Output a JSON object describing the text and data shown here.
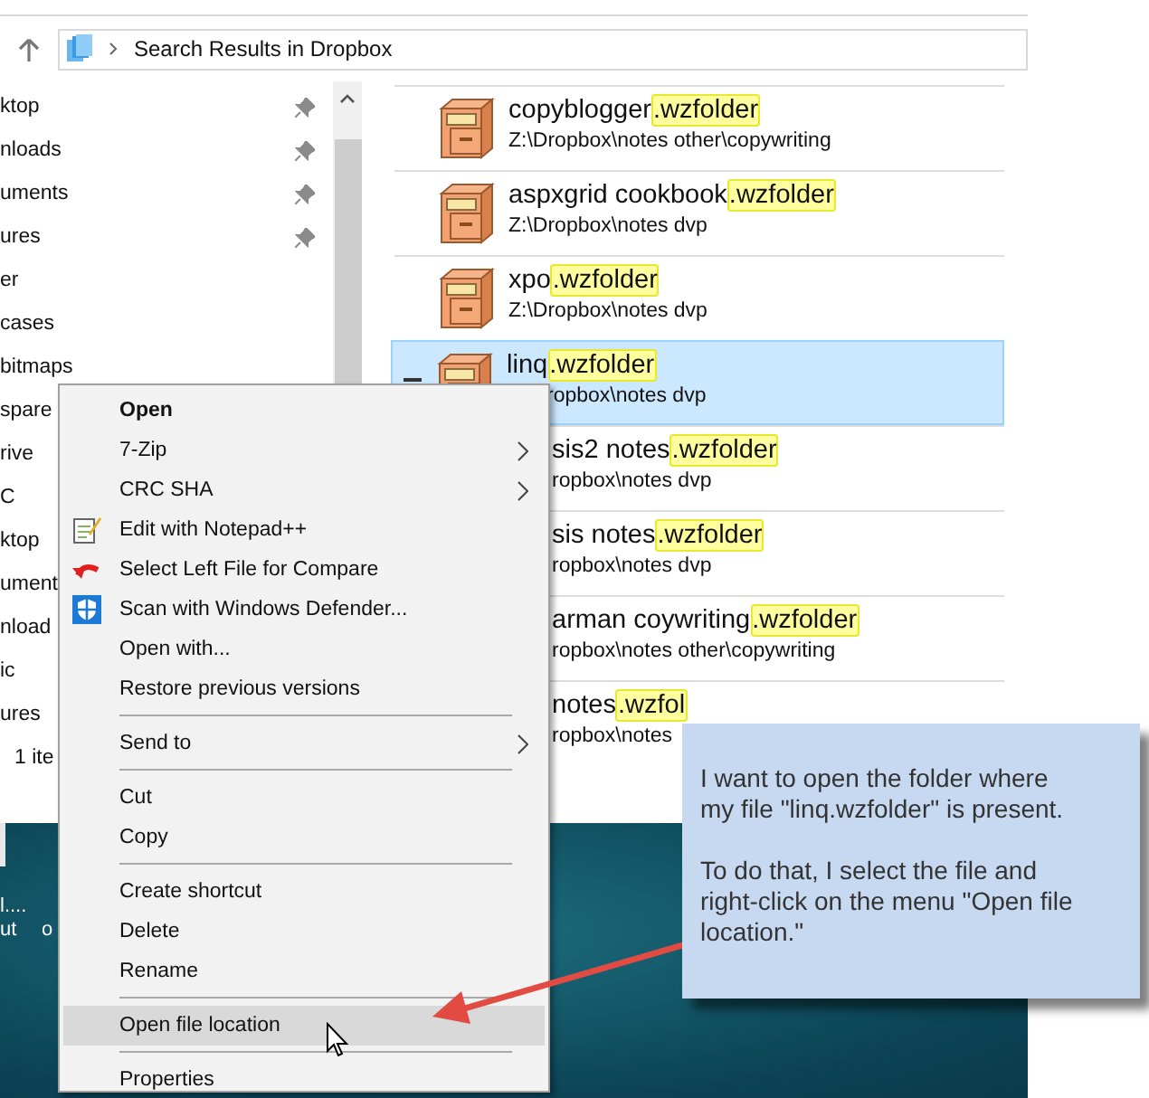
{
  "address_bar": {
    "path": "Search Results in Dropbox"
  },
  "nav_items": [
    {
      "label": "ktop",
      "pinned": true
    },
    {
      "label": "nloads",
      "pinned": true
    },
    {
      "label": "uments",
      "pinned": true
    },
    {
      "label": "ures",
      "pinned": true
    },
    {
      "label": "er",
      "pinned": false
    },
    {
      "label": "cases",
      "pinned": false
    },
    {
      "label": "bitmaps",
      "pinned": false
    },
    {
      "label": "spare",
      "pinned": false
    },
    {
      "label": "rive",
      "pinned": false
    },
    {
      "label": "C",
      "pinned": false
    },
    {
      "label": "ktop",
      "pinned": false
    },
    {
      "label": "ument",
      "pinned": false
    },
    {
      "label": "nload",
      "pinned": false
    },
    {
      "label": "ic",
      "pinned": false
    },
    {
      "label": "ures",
      "pinned": false
    }
  ],
  "status_bar": "1 ite",
  "results": [
    {
      "name": "copyblogger",
      "match": ".wzfolder",
      "path": "Z:\\Dropbox\\notes other\\copywriting",
      "selected": false,
      "covered": false
    },
    {
      "name": "aspxgrid cookbook",
      "match": ".wzfolder",
      "path": "Z:\\Dropbox\\notes dvp",
      "selected": false,
      "covered": false
    },
    {
      "name": "xpo",
      "match": ".wzfolder",
      "path": "Z:\\Dropbox\\notes dvp",
      "selected": false,
      "covered": false
    },
    {
      "name": "linq",
      "match": ".wzfolder",
      "path": "ropbox\\notes dvp",
      "selected": true,
      "covered": false
    },
    {
      "name": "sis2 notes",
      "match": ".wzfolder",
      "path": "ropbox\\notes dvp",
      "selected": false,
      "covered": true
    },
    {
      "name": "sis notes",
      "match": ".wzfolder",
      "path": "ropbox\\notes dvp",
      "selected": false,
      "covered": true
    },
    {
      "name": "arman coywriting",
      "match": ".wzfolder",
      "path": "ropbox\\notes other\\copywriting",
      "selected": false,
      "covered": true
    },
    {
      "name": "notes",
      "match": ".wzfol",
      "path": "ropbox\\notes",
      "selected": false,
      "covered": true
    }
  ],
  "desktop_labels": [
    "l....",
    "ut",
    "o"
  ],
  "context_menu": [
    {
      "kind": "item",
      "label": "Open",
      "bold": true,
      "submenu": false,
      "selected": false
    },
    {
      "kind": "item",
      "label": "7-Zip",
      "bold": false,
      "submenu": true,
      "selected": false
    },
    {
      "kind": "item",
      "label": "CRC SHA",
      "bold": false,
      "submenu": true,
      "selected": false
    },
    {
      "kind": "item",
      "label": "Edit with Notepad++",
      "bold": false,
      "submenu": false,
      "selected": false
    },
    {
      "kind": "item",
      "label": "Select Left File for Compare",
      "bold": false,
      "submenu": false,
      "selected": false
    },
    {
      "kind": "item",
      "label": "Scan with Windows Defender...",
      "bold": false,
      "submenu": false,
      "selected": false
    },
    {
      "kind": "item",
      "label": "Open with...",
      "bold": false,
      "submenu": false,
      "selected": false
    },
    {
      "kind": "item",
      "label": "Restore previous versions",
      "bold": false,
      "submenu": false,
      "selected": false
    },
    {
      "kind": "separator"
    },
    {
      "kind": "item",
      "label": "Send to",
      "bold": false,
      "submenu": true,
      "selected": false
    },
    {
      "kind": "separator"
    },
    {
      "kind": "item",
      "label": "Cut",
      "bold": false,
      "submenu": false,
      "selected": false
    },
    {
      "kind": "item",
      "label": "Copy",
      "bold": false,
      "submenu": false,
      "selected": false
    },
    {
      "kind": "separator"
    },
    {
      "kind": "item",
      "label": "Create shortcut",
      "bold": false,
      "submenu": false,
      "selected": false
    },
    {
      "kind": "item",
      "label": "Delete",
      "bold": false,
      "submenu": false,
      "selected": false
    },
    {
      "kind": "item",
      "label": "Rename",
      "bold": false,
      "submenu": false,
      "selected": false
    },
    {
      "kind": "separator"
    },
    {
      "kind": "item",
      "label": "Open file location",
      "bold": false,
      "submenu": false,
      "selected": true
    },
    {
      "kind": "separator"
    },
    {
      "kind": "item",
      "label": "Properties",
      "bold": false,
      "submenu": false,
      "selected": false
    }
  ],
  "callout": {
    "paragraphs": [
      "I want to open the folder where my file \"linq.wzfolder\" is present.",
      "To do that, I select the file and right-click on the menu \"Open file location.\""
    ]
  }
}
